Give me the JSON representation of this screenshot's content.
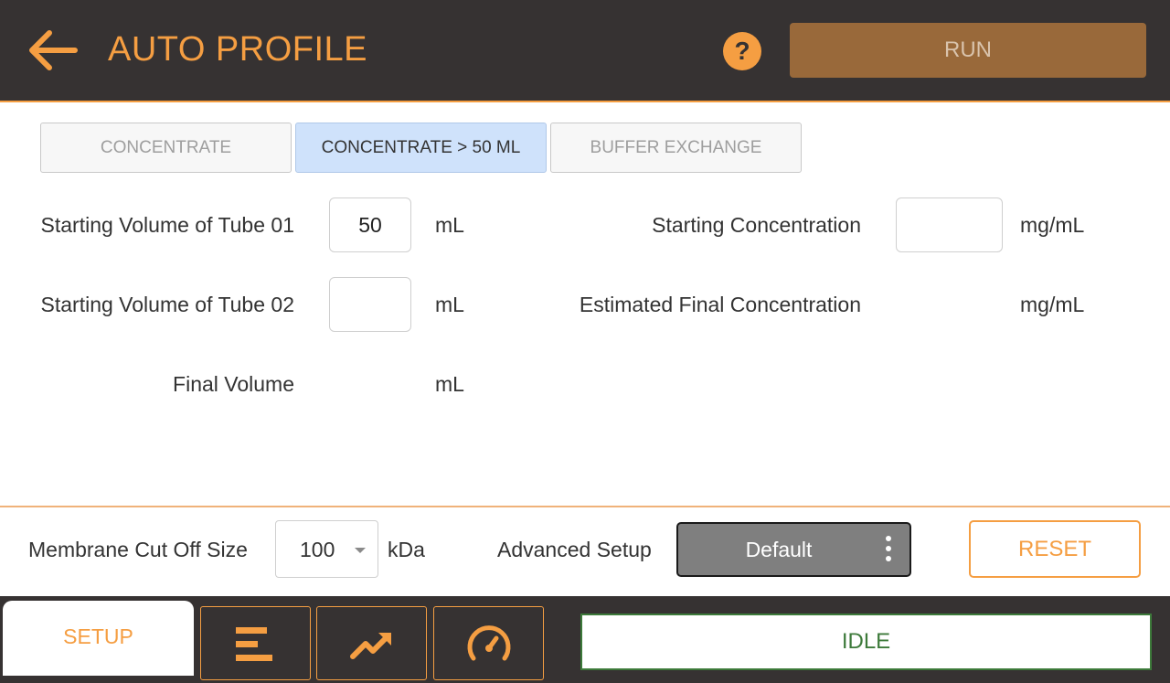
{
  "header": {
    "title": "AUTO PROFILE",
    "help_label": "?",
    "run_label": "RUN"
  },
  "tabs": [
    {
      "label": "CONCENTRATE",
      "active": false
    },
    {
      "label": "CONCENTRATE > 50 ML",
      "active": true
    },
    {
      "label": "BUFFER EXCHANGE",
      "active": false
    }
  ],
  "form": {
    "tube01": {
      "label": "Starting Volume of Tube 01",
      "value": "50",
      "unit": "mL"
    },
    "tube02": {
      "label": "Starting Volume of Tube 02",
      "value": "",
      "unit": "mL"
    },
    "final_volume": {
      "label": "Final Volume",
      "value": "",
      "unit": "mL"
    },
    "starting_conc": {
      "label": "Starting Concentration",
      "value": "",
      "unit": "mg/mL"
    },
    "est_final_conc": {
      "label": "Estimated Final Concentration",
      "value": "",
      "unit": "mg/mL"
    }
  },
  "footer": {
    "membrane_label": "Membrane Cut Off Size",
    "membrane_value": "100",
    "membrane_unit": "kDa",
    "advanced_label": "Advanced Setup",
    "advanced_value": "Default",
    "reset_label": "RESET"
  },
  "bottom_nav": {
    "setup_label": "SETUP",
    "icons": [
      "list-icon",
      "trend-up-icon",
      "gauge-icon"
    ],
    "status": "IDLE"
  },
  "colors": {
    "accent": "#f59e42",
    "header_bg": "#363232",
    "run_bg": "#99693a",
    "active_tab": "#cfe2fb",
    "status_green": "#3d7a3a"
  }
}
